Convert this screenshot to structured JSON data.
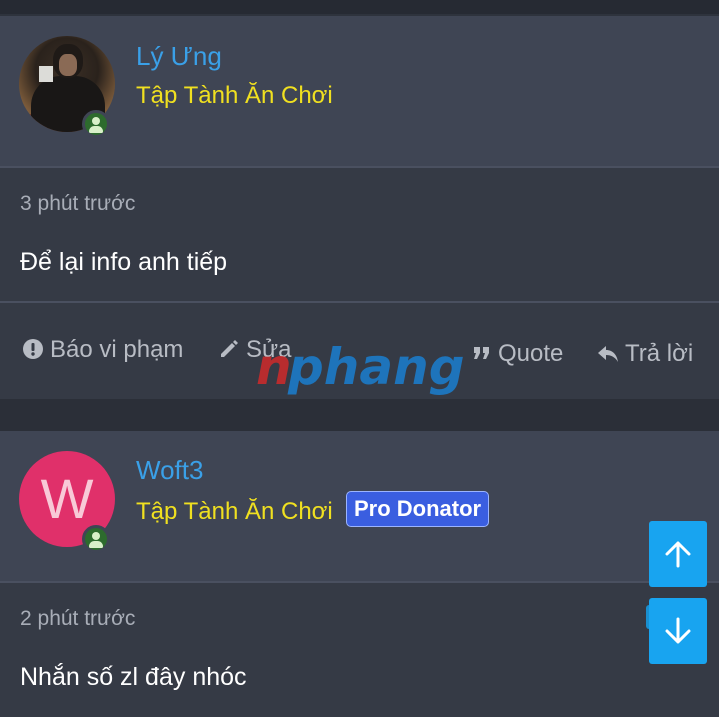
{
  "posts": [
    {
      "author": "Lý Ưng",
      "user_title": "Tập Tành Ăn Chơi",
      "time": "3 phút trước",
      "content": "Để lại info anh tiếp",
      "actions": {
        "report": "Báo vi phạm",
        "edit": "Sửa",
        "quote": "Quote",
        "reply": "Trả lời"
      }
    },
    {
      "author": "Woft3",
      "avatar_letter": "W",
      "user_title": "Tập Tành Ăn Chơi",
      "badge": "Pro Donator",
      "time": "2 phút trước",
      "content": "Nhắn số zl đây nhóc"
    }
  ],
  "watermark": "nphang",
  "colors": {
    "username": "#3aa0e8",
    "user_title": "#f0e020",
    "badge": "#3a5ee0",
    "scroll_button": "#18a4f0",
    "avatar_w": "#e0306a"
  },
  "icons": [
    "online-status-icon",
    "report-icon",
    "edit-icon",
    "quote-icon",
    "reply-icon",
    "arrow-up-icon",
    "arrow-down-icon"
  ]
}
